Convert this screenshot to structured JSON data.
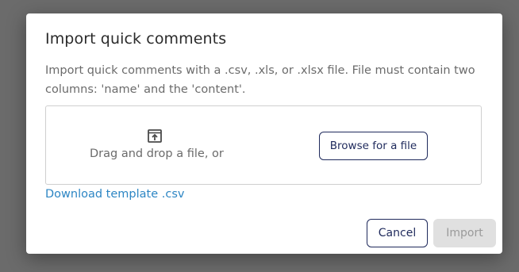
{
  "dialog": {
    "title": "Import quick comments",
    "description": "Import quick comments with a .csv, .xls, or .xlsx file. File must contain two columns: 'name' and the 'content'.",
    "dropzone": {
      "icon": "upload-file-icon",
      "text": "Drag and drop a file, or",
      "browse_label": "Browse for a file"
    },
    "template_link": "Download template .csv",
    "cancel_label": "Cancel",
    "import_label": "Import",
    "import_disabled": true
  },
  "colors": {
    "overlay": "#6b6b6b",
    "primary_outline": "#1f2a5c",
    "link": "#2d86c4",
    "disabled_bg": "#e0e0e0",
    "disabled_text": "#9a9a9a"
  }
}
